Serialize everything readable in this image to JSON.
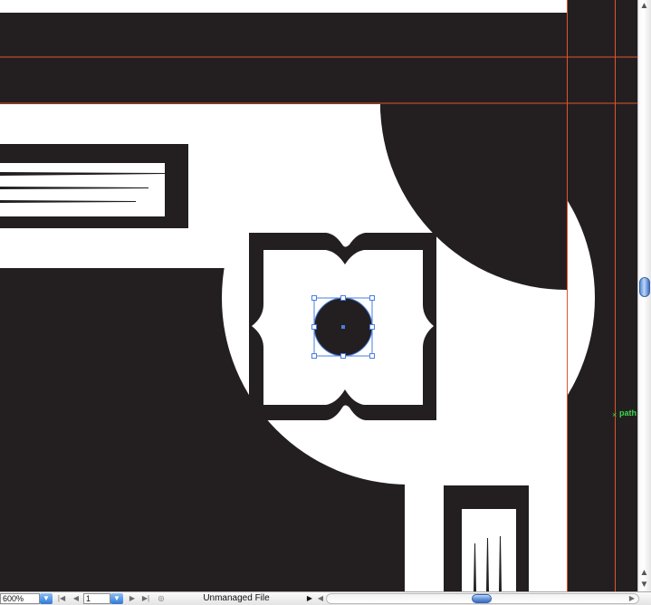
{
  "canvas": {
    "colors": {
      "background": "#ffffff",
      "artwork": "#231f20",
      "guides": "#e0542b",
      "selection": "#4a7ee0",
      "smart_guide": "#3bd84a"
    },
    "smart_guide_label": "path"
  },
  "statusbar": {
    "zoom_value": "600%",
    "artboard_value": "1",
    "status_text": "Unmanaged File",
    "icons": {
      "zoom_dropdown": "chevron-down-icon",
      "first": "first-artboard-icon",
      "prev": "previous-artboard-icon",
      "next": "next-artboard-icon",
      "last": "last-artboard-icon",
      "artboard_dropdown": "chevron-down-icon",
      "status_menu": "status-menu-icon",
      "status_arrow": "play-arrow-icon"
    }
  },
  "scrollbars": {
    "vertical": {
      "position": 0.48
    },
    "horizontal": {
      "position": 0.48
    }
  }
}
